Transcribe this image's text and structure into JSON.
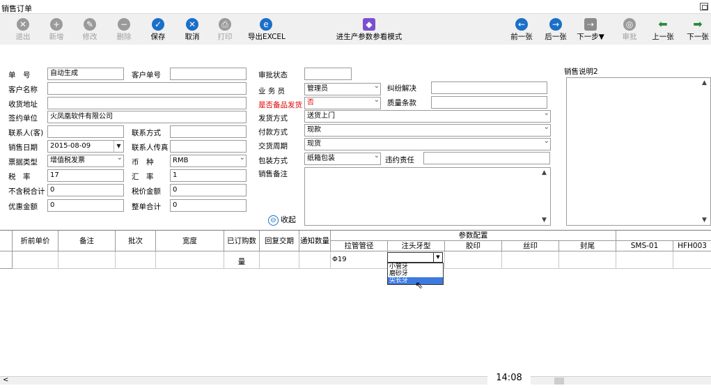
{
  "window": {
    "title": "销售订单"
  },
  "toolbar": {
    "exit": "退出",
    "new": "新增",
    "edit": "修改",
    "delete": "删除",
    "save": "保存",
    "cancel": "取消",
    "print": "打印",
    "export": "导出EXCEL",
    "param_mode": "进生产参数参看模式",
    "prev": "前一张",
    "next": "后一张",
    "next_step": "下一步▼",
    "approve": "审批",
    "up": "上一张",
    "down": "下一张"
  },
  "form": {
    "order_no": {
      "label": "单　号",
      "value": "自动生成"
    },
    "customer_order_no": {
      "label": "客户单号",
      "value": ""
    },
    "approval_status": {
      "label": "审批状态",
      "value": ""
    },
    "customer_name": {
      "label": "客户名称",
      "value": ""
    },
    "salesperson": {
      "label": "业 务 员",
      "value": "管理员"
    },
    "dispute": {
      "label": "纠纷解决",
      "value": ""
    },
    "ship_address": {
      "label": "收货地址",
      "value": ""
    },
    "backup_ship": {
      "label": "是否备品发货",
      "value": "否"
    },
    "quality": {
      "label": "质量条款",
      "value": ""
    },
    "sign_unit": {
      "label": "签约单位",
      "value": "火凤凰软件有限公司"
    },
    "ship_method": {
      "label": "发货方式",
      "value": "送货上门"
    },
    "contact": {
      "label": "联系人(客)",
      "value": ""
    },
    "contact_way": {
      "label": "联系方式",
      "value": ""
    },
    "pay_method": {
      "label": "付款方式",
      "value": "现款"
    },
    "sale_date": {
      "label": "销售日期",
      "value": "2015-08-09"
    },
    "contact_fax": {
      "label": "联系人传真",
      "value": ""
    },
    "delivery_cycle": {
      "label": "交货周期",
      "value": "现货"
    },
    "invoice_type": {
      "label": "票据类型",
      "value": "增值税发票"
    },
    "currency": {
      "label": "币　种",
      "value": "RMB"
    },
    "packing": {
      "label": "包装方式",
      "value": "纸箱包装"
    },
    "breach": {
      "label": "违约责任",
      "value": ""
    },
    "tax_rate": {
      "label": "税　率",
      "value": "17"
    },
    "exchange_rate": {
      "label": "汇　率",
      "value": "1"
    },
    "sale_note": {
      "label": "销售备注"
    },
    "ex_tax_total": {
      "label": "不含税合计",
      "value": "0"
    },
    "tax_total": {
      "label": "税价金额",
      "value": "0"
    },
    "discount": {
      "label": "优惠金额",
      "value": "0"
    },
    "order_total": {
      "label": "整单合计",
      "value": "0"
    },
    "sale_desc2": {
      "label": "销售说明2"
    },
    "collapse": "收起"
  },
  "grid": {
    "headers": {
      "discount_price": "折前单价",
      "remark": "备注",
      "batch": "批次",
      "width": "宽度",
      "ordered_qty": "已订购数量",
      "reply_date": "回复交期",
      "notice_qty": "通知数量",
      "param_group": "参数配置",
      "pull_pipe": "拉管管径",
      "nozzle": "注头牙型",
      "glue": "胶印",
      "silk": "丝印",
      "seal": "封尾",
      "sms": "SMS-01",
      "hfh": "HFH003"
    },
    "row1": {
      "pull_pipe": "Φ19"
    },
    "nozzle_options": [
      "小管牙",
      "磨砂牙",
      "尖长牙"
    ]
  },
  "clock": "14:08"
}
